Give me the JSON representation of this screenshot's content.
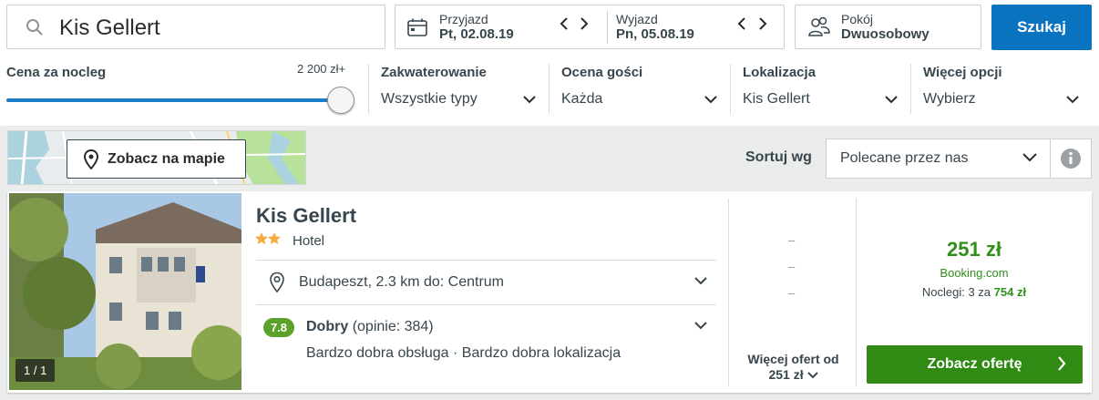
{
  "search": {
    "query": "Kis Gellert",
    "button_label": "Szukaj"
  },
  "dates": {
    "checkin_label": "Przyjazd",
    "checkin_value": "Pt, 02.08.19",
    "checkout_label": "Wyjazd",
    "checkout_value": "Pn, 05.08.19"
  },
  "room": {
    "label": "Pokój",
    "value": "Dwuosobowy"
  },
  "filters": {
    "price_label": "Cena za nocleg",
    "price_max": "2 200 zł+",
    "price_slider_level": 1.0,
    "accommodation": {
      "label": "Zakwaterowanie",
      "value": "Wszystkie typy"
    },
    "rating": {
      "label": "Ocena gości",
      "value": "Każda"
    },
    "location": {
      "label": "Lokalizacja",
      "value": "Kis Gellert"
    },
    "more": {
      "label": "Więcej opcji",
      "value": "Wybierz"
    }
  },
  "map": {
    "button_label": "Zobacz na mapie"
  },
  "sort": {
    "label": "Sortuj wg",
    "value": "Polecane przez nas"
  },
  "hotel": {
    "name": "Kis Gellert",
    "stars": 2,
    "type": "Hotel",
    "photo_counter": "1 / 1",
    "location": "Budapeszt, 2.3 km do: Centrum",
    "rating_score": "7.8",
    "rating_word": "Dobry",
    "rating_count": "(opinie: 384)",
    "rating_desc": "Bardzo dobra obsługa · Bardzo dobra lokalizacja",
    "other_prices": [
      "–",
      "–",
      "–"
    ],
    "more_offers_line1": "Więcej ofert od",
    "more_offers_line2": "251 zł",
    "price": "251 zł",
    "provider": "Booking.com",
    "nights_prefix": "Noclegi: 3 za",
    "nights_total": "754 zł",
    "offer_button": "Zobacz ofertę"
  },
  "colors": {
    "accent_blue": "#0a73c0",
    "deal_green": "#308a14",
    "rating_green": "#5ba22c",
    "star_orange": "#f6ab3f"
  },
  "icons": [
    "search-icon",
    "calendar-icon",
    "chevron-left-icon",
    "chevron-right-icon",
    "people-icon",
    "chevron-down-icon",
    "map-pin-icon",
    "info-icon",
    "chevron-right-icon"
  ]
}
